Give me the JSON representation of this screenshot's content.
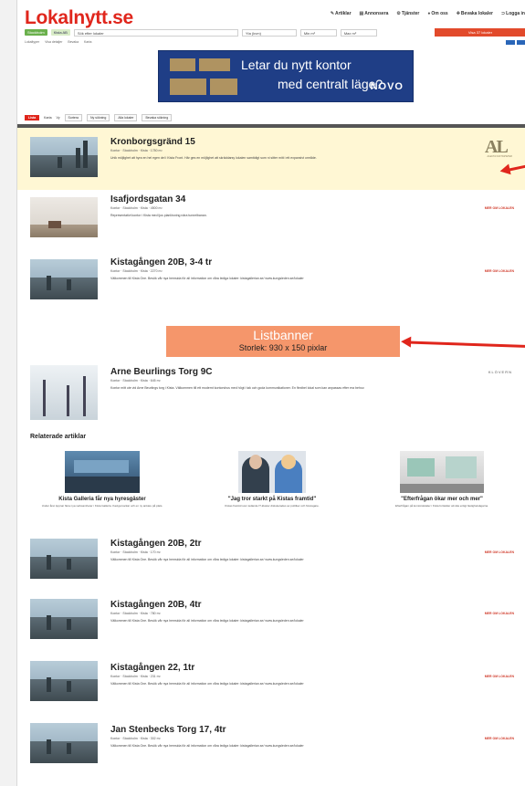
{
  "header": {
    "logo": "Lokalnytt.se",
    "nav": [
      "Artiklar",
      "Annonsera",
      "Tjänster",
      "Om oss",
      "Bevaka lokaler",
      "Logga in"
    ]
  },
  "search": {
    "tags": [
      "Stockholm",
      "Kista AB"
    ],
    "query": "Sök efter lokaler",
    "fields": [
      "Yta (kvm)",
      "Min m²",
      "Max m²"
    ],
    "button": "Visa 37 lokaler"
  },
  "subnav": [
    "Lokaltyper",
    "Visa detaljer",
    "Bevaka",
    "Karta"
  ],
  "top_ad": {
    "line1": "Letar du nytt kontor",
    "line2": "med centralt läge?",
    "brand": "NOVO"
  },
  "toolbar": {
    "list": "Lista",
    "items": [
      "Karta",
      "Vy",
      "Sortera",
      "Ny sökning",
      "Alla lokaler",
      "Bevaka sökning"
    ]
  },
  "listings": [
    {
      "title": "Kronborgsgränd 15",
      "meta": "Kontor · Stockholm · Kista · 1780 m²",
      "desc": "Unik möjlighet att hyra en hel egen del i Kista Front. Här ges en möjlighet att skräddarsy lokalen samtidigt som ni sitter mitt i ett expansivt område.",
      "more": "",
      "logo": "AL",
      "logo_sub": "ALECTA FASTIGHETER"
    },
    {
      "title": "Isafjordsgatan 34",
      "meta": "Kontor · Stockholm · Kista · 4500 m²",
      "desc": "Representativt kontor i Kista med ljus planlösning nära tunnelbanan.",
      "more": "MER OM LOKALEN",
      "logo": "",
      "logo_sub": ""
    },
    {
      "title": "Kistagången 20B, 3-4 tr",
      "meta": "Kontor · Stockholm · Kista · 2270 m²",
      "desc": "Välkommen till Kista One. Besök vår nya hemsida för all information om våra lediga lokaler: kistagallerian.se/ www.kungsleden.se/lokaler",
      "more": "MER OM LOKALEN",
      "logo": "",
      "logo_sub": ""
    },
    {
      "title": "Arne Beurlings Torg 9C",
      "meta": "Kontor · Stockholm · Kista · 645 m²",
      "desc": "Kontor mitt ute vid Arne Beurlings torg i Kista. Välkommen till ett modernt kontorshus med högt i tak och goda kommunikationer. En flexibel lokal som kan anpassas efter era behov.",
      "more": "",
      "logo": "KLÖVERN",
      "logo_sub": ""
    },
    {
      "title": "Kistagången 20B, 2tr",
      "meta": "Kontor · Stockholm · Kista · 170 m²",
      "desc": "Välkommen till Kista One. Besök vår nya hemsida för all information om våra lediga lokaler: kistagallerian.se/ www.kungsleden.se/lokaler",
      "more": "MER OM LOKALEN",
      "logo": "",
      "logo_sub": ""
    },
    {
      "title": "Kistagången 20B, 4tr",
      "meta": "Kontor · Stockholm · Kista · 780 m²",
      "desc": "Välkommen till Kista One. Besök vår nya hemsida för all information om våra lediga lokaler: kistagallerian.se/ www.kungsleden.se/lokaler",
      "more": "MER OM LOKALEN",
      "logo": "",
      "logo_sub": ""
    },
    {
      "title": "Kistagången 22, 1tr",
      "meta": "Kontor · Stockholm · Kista · 231 m²",
      "desc": "Välkommen till Kista One. Besök vår nya hemsida för all information om våra lediga lokaler: kistagallerian.se/ www.kungsleden.se/lokaler",
      "more": "MER OM LOKALEN",
      "logo": "",
      "logo_sub": ""
    },
    {
      "title": "Jan Stenbecks Torg 17, 4tr",
      "meta": "Kontor · Stockholm · Kista · 302 m²",
      "desc": "Välkommen till Kista One. Besök vår nya hemsida för all information om våra lediga lokaler: kistagallerian.se/ www.kungsleden.se/lokaler",
      "more": "MER OM LOKALEN",
      "logo": "",
      "logo_sub": ""
    }
  ],
  "listbanner": {
    "title": "Listbanner",
    "size": "Storlek: 930 x 150 pixlar"
  },
  "related": {
    "heading": "Relaterade artiklar",
    "items": [
      {
        "title": "Kista Galleria får nya hyresgäster",
        "sub": "Under året öppnar flera nya verksamheter i Kista Galleria. Kaxiga kockar och en ny ankare på plats."
      },
      {
        "title": "\"Jag tror starkt på Kistas framtid\"",
        "sub": "Kistas framtid som ledande IT-kluster diskuterades av politiker och företagare."
      },
      {
        "title": "\"Efterfrågan ökar mer och mer\"",
        "sub": "Efterfrågan på kontorslokaler i Kista fortsätter att öka enligt fastighetsägarna."
      }
    ]
  },
  "colors": {
    "brand_red": "#e0261c",
    "banner": "#f5966b",
    "highlight": "#fff7d4"
  }
}
